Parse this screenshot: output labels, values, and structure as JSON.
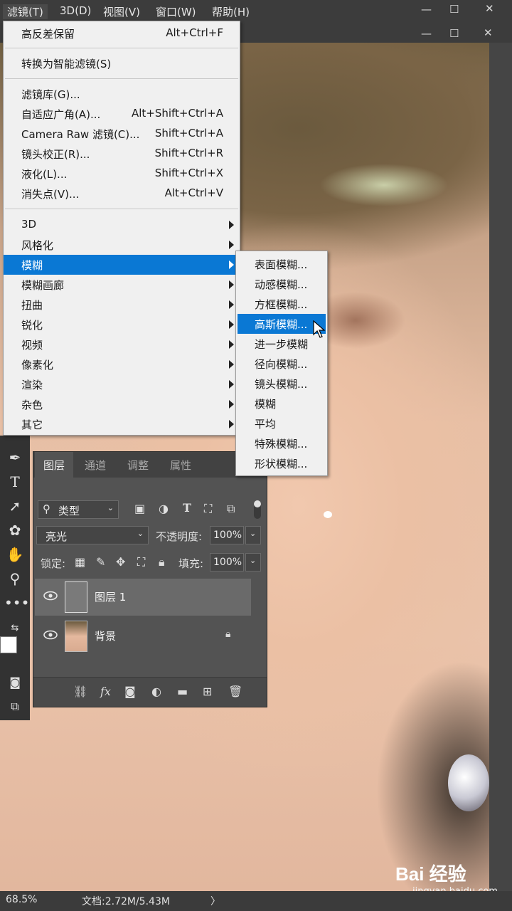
{
  "menubar": {
    "items": [
      "滤镜(T)",
      "3D(D)",
      "视图(V)",
      "窗口(W)",
      "帮助(H)"
    ],
    "win_min": "—",
    "win_max": "☐",
    "win_close": "✕"
  },
  "filter_menu": {
    "last_filter": {
      "label": "高反差保留",
      "shortcut": "Alt+Ctrl+F"
    },
    "convert_smart": {
      "label": "转换为智能滤镜(S)"
    },
    "group2": [
      {
        "label": "滤镜库(G)...",
        "shortcut": ""
      },
      {
        "label": "自适应广角(A)...",
        "shortcut": "Alt+Shift+Ctrl+A"
      },
      {
        "label": "Camera Raw 滤镜(C)...",
        "shortcut": "Shift+Ctrl+A"
      },
      {
        "label": "镜头校正(R)...",
        "shortcut": "Shift+Ctrl+R"
      },
      {
        "label": "液化(L)...",
        "shortcut": "Shift+Ctrl+X"
      },
      {
        "label": "消失点(V)...",
        "shortcut": "Alt+Ctrl+V"
      }
    ],
    "group3": [
      "3D",
      "风格化",
      "模糊",
      "模糊画廊",
      "扭曲",
      "锐化",
      "视频",
      "像素化",
      "渲染",
      "杂色",
      "其它"
    ],
    "highlighted": "模糊"
  },
  "blur_submenu": {
    "items": [
      "表面模糊...",
      "动感模糊...",
      "方框模糊...",
      "高斯模糊...",
      "进一步模糊",
      "径向模糊...",
      "镜头模糊...",
      "模糊",
      "平均",
      "特殊模糊...",
      "形状模糊..."
    ],
    "highlighted": "高斯模糊..."
  },
  "layers_panel": {
    "tabs": [
      "图层",
      "通道",
      "调整",
      "属性"
    ],
    "active_tab": "图层",
    "filter_kind": "类型",
    "blend_mode": "亮光",
    "opacity_label": "不透明度:",
    "opacity_value": "100%",
    "lock_label": "锁定:",
    "fill_label": "填充:",
    "fill_value": "100%",
    "layers": [
      {
        "name": "图层 1",
        "visible": true,
        "selected": true,
        "locked": false
      },
      {
        "name": "背景",
        "visible": true,
        "selected": false,
        "locked": true
      }
    ]
  },
  "statusbar": {
    "zoom": "68.5%",
    "doc_info": "文档:2.72M/5.43M",
    "arrow": "〉"
  },
  "watermark": {
    "brand": "Bai 经验",
    "url": "jingyan.baidu.com"
  },
  "colors": {
    "menu_highlight": "#0a78d4",
    "menu_bg": "#f0f0f0",
    "panel_bg": "#535353",
    "chrome_bg": "#3c3c3c"
  }
}
